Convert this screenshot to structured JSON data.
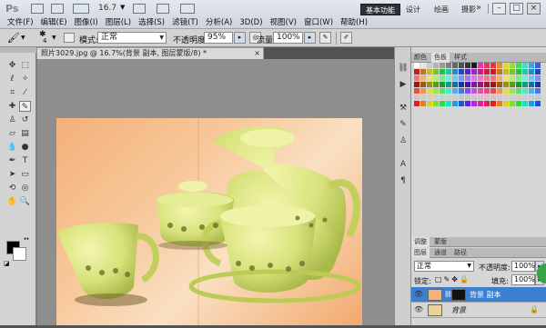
{
  "app": {
    "logo": "Ps",
    "zoom": "16.7"
  },
  "workspaces": {
    "basic": "基本功能",
    "design": "设计",
    "paint": "绘画",
    "photo": "摄影",
    "more": "»"
  },
  "window": {
    "minimize": "–",
    "restore": "□",
    "close": "×"
  },
  "menu": [
    "文件(F)",
    "编辑(E)",
    "图像(I)",
    "图层(L)",
    "选择(S)",
    "滤镜(T)",
    "分析(A)",
    "3D(D)",
    "视图(V)",
    "窗口(W)",
    "帮助(H)"
  ],
  "options": {
    "brush_size": "4",
    "mode_label": "模式:",
    "mode_value": "正常",
    "opacity_label": "不透明度:",
    "opacity_value": "95%",
    "flow_label": "流量:",
    "flow_value": "100%"
  },
  "document": {
    "tab_title": "照片3029.jpg @ 16.7%(背景 副本, 图层蒙版/8) *",
    "tab_close": "×"
  },
  "panels": {
    "top_tabs": [
      "颜色",
      "色板",
      "样式"
    ],
    "adjust_tabs": [
      "调整",
      "蒙版"
    ],
    "layer_tabs": [
      "图层",
      "通道",
      "路径"
    ]
  },
  "layers": {
    "blend_mode": "正常",
    "opacity_label": "不透明度:",
    "opacity_value": "100%",
    "lock_label": "锁定:",
    "fill_label": "填充:",
    "fill_value": "100%",
    "items": [
      {
        "name": "背景 副本",
        "selected": true
      },
      {
        "name": "背景",
        "selected": false
      }
    ]
  },
  "colors": {
    "selection": "#3a7fd1",
    "active_workspace": "#2d3238",
    "accent_green": "#36a548"
  },
  "icons": [
    "brush-icon",
    "move-icon",
    "marquee-icon",
    "lasso-icon",
    "crop-icon",
    "eyedropper-icon",
    "healing-icon",
    "brush-tool-icon",
    "stamp-icon",
    "history-brush-icon",
    "eraser-icon",
    "gradient-icon",
    "blur-icon",
    "dodge-icon",
    "pen-icon",
    "type-icon",
    "path-select-icon",
    "shape-icon",
    "hand-icon",
    "zoom-icon",
    "eye-icon",
    "lock-icon",
    "mask-icon"
  ]
}
